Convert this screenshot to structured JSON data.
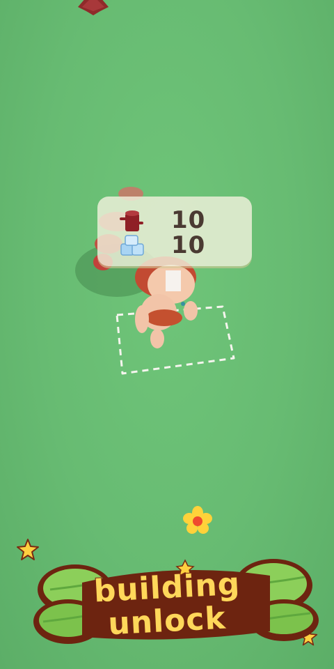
{
  "game": {
    "scene": "grass-field",
    "resources": [
      {
        "icon": "wood-log-icon",
        "count": "10"
      },
      {
        "icon": "ice-block-icon",
        "count": "10"
      }
    ],
    "banner": {
      "line1": "building",
      "line2": "unlock"
    }
  },
  "colors": {
    "grass": "#67bb72",
    "popup_bg": "#f0f0dc",
    "count_text": "#4a3a32",
    "banner_text": "#ffd75a",
    "banner_outline": "#7a2a12",
    "leaf": "#8ccf5a"
  }
}
